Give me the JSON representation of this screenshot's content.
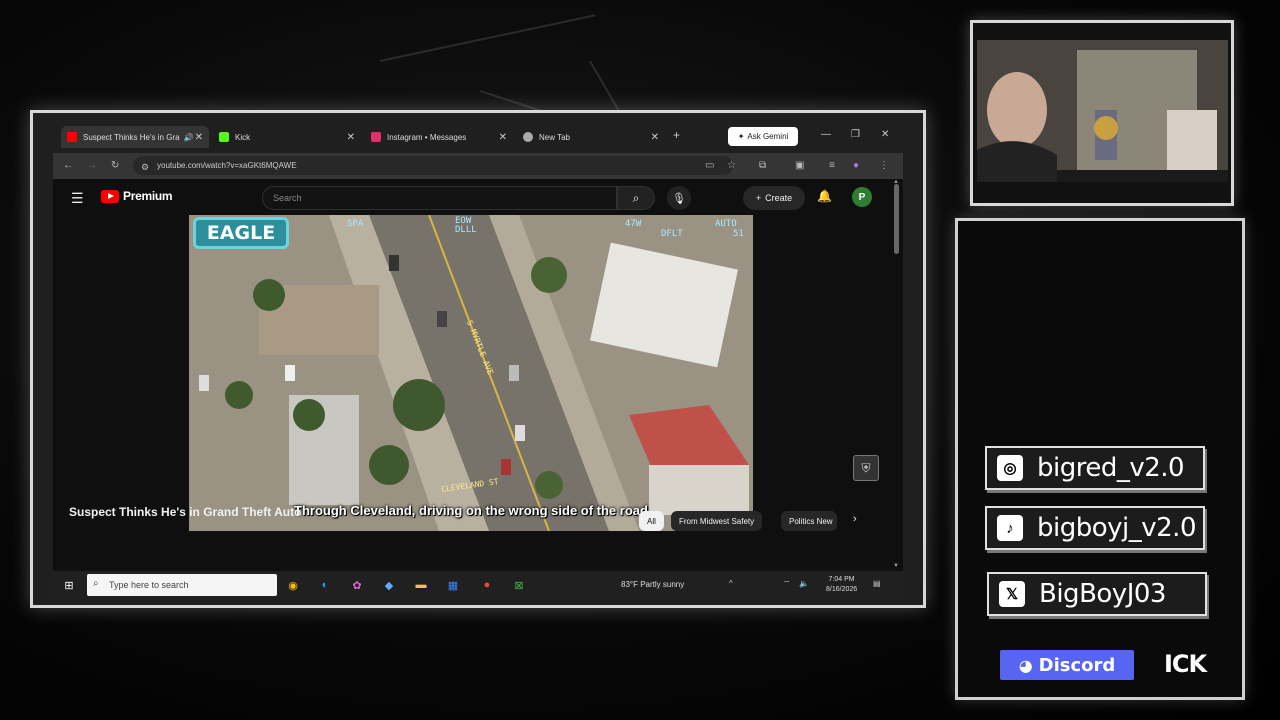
{
  "browser": {
    "tabs": [
      {
        "label": "Suspect Thinks He's in Gra",
        "icon": "youtube-icon",
        "color": "#ff0000"
      },
      {
        "label": "Kick",
        "icon": "kick-icon",
        "color": "#53fc18"
      },
      {
        "label": "Instagram • Messages",
        "icon": "instagram-icon",
        "color": "#e1306c"
      },
      {
        "label": "New Tab",
        "icon": "chrome-icon",
        "color": "#aaaaaa"
      }
    ],
    "gemini_label": "Ask Gemini",
    "url": "youtube.com/watch?v=xaGKt6MQAWE"
  },
  "youtube": {
    "brand": "Premium",
    "search_placeholder": "Search",
    "create_label": "Create",
    "avatar_letter": "P",
    "video": {
      "badge": "EAGLE",
      "hud_left": "SPA",
      "hud_center": "EOW\nDLLL",
      "hud_right_top": "47W",
      "hud_right_2": "AUTO",
      "hud_right_3": "DFLT",
      "hud_right_4": "51",
      "street_1": "S MYRTLE AVE",
      "street_2": "CLEVELAND ST",
      "subtitle": "Through Cleveland, driving on the wrong side of the road"
    },
    "title": "Suspect Thinks He's in Grand Theft Auto",
    "chips": [
      "All",
      "From Midwest Safety",
      "Politics New"
    ]
  },
  "taskbar": {
    "search_placeholder": "Type here to search",
    "weather": "83°F  Partly sunny",
    "time": "7:04 PM",
    "date": "8/16/2026"
  },
  "socials": [
    {
      "icon": "instagram-icon",
      "handle": "bigred_v2.0"
    },
    {
      "icon": "tiktok-icon",
      "handle": "bigboyj_v2.0"
    },
    {
      "icon": "x-icon",
      "handle": "BigBoyJ03"
    }
  ],
  "discord_label": "Discord",
  "kick_label": "ICK",
  "colors": {
    "youtube_red": "#ff0000",
    "discord": "#5865f2",
    "eagle_badge": "#2c8f9c"
  }
}
